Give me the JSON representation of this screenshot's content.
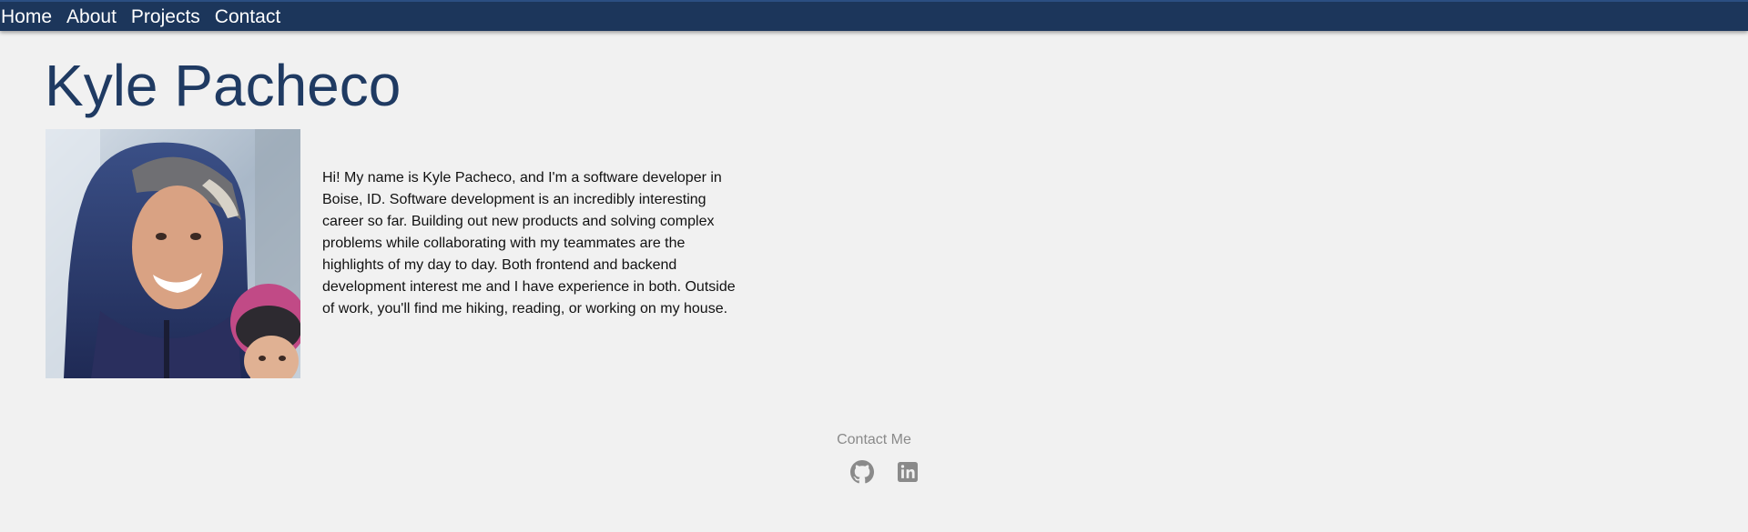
{
  "nav": {
    "items": [
      {
        "label": "Home"
      },
      {
        "label": "About"
      },
      {
        "label": "Projects"
      },
      {
        "label": "Contact"
      }
    ]
  },
  "header": {
    "title": "Kyle Pacheco"
  },
  "about": {
    "bio": "Hi! My name is Kyle Pacheco, and I'm a software developer in Boise, ID. Software development is an incredibly interesting career so far. Building out new products and solving complex problems while collaborating with my teammates are the highlights of my day to day. Both frontend and backend development interest me and I have experience in both. Outside of work, you'll find me hiking, reading, or working on my house."
  },
  "footer": {
    "heading": "Contact Me",
    "links": [
      {
        "icon": "github-icon"
      },
      {
        "icon": "linkedin-icon"
      }
    ]
  },
  "colors": {
    "nav_bg": "#1c365b",
    "title": "#1f3a62",
    "page_bg": "#f1f1f1",
    "muted": "#8a8a8a"
  }
}
